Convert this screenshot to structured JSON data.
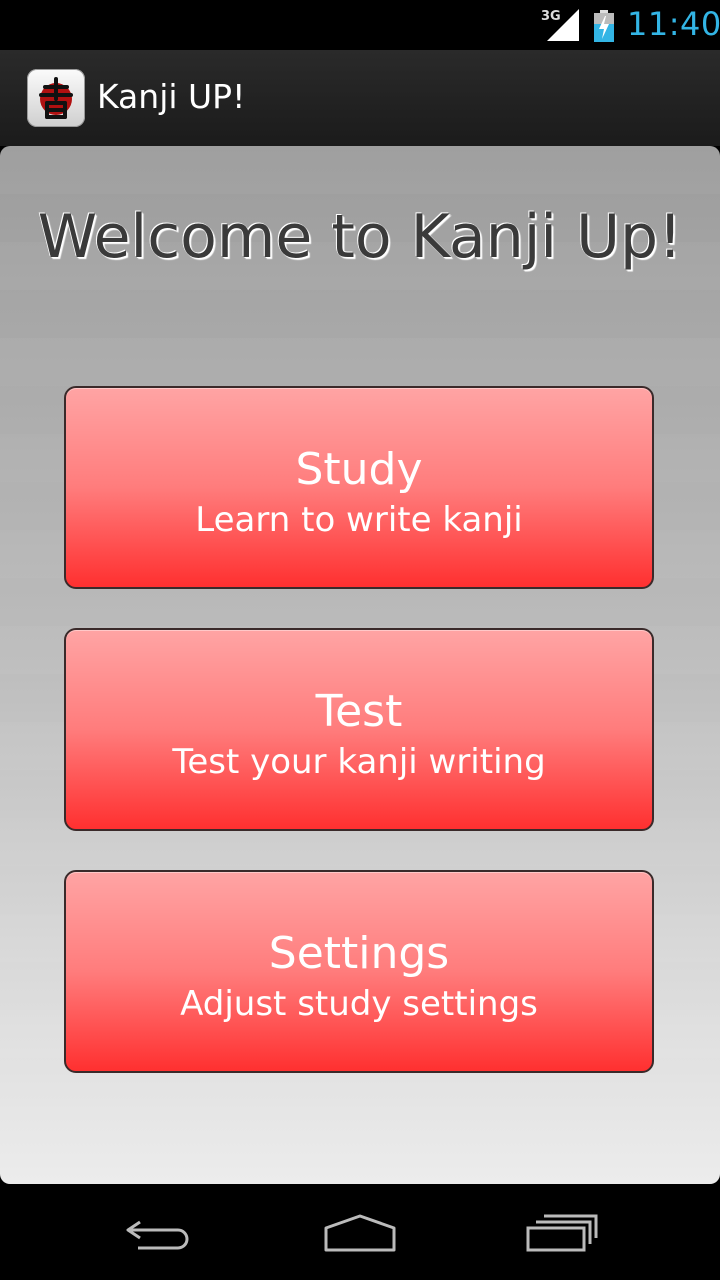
{
  "status_bar": {
    "network_label": "3G",
    "time": "11:40",
    "signal_icon": "signal-icon",
    "battery_icon": "battery-charging-icon"
  },
  "action_bar": {
    "app_icon": "kanji-app-icon",
    "title": "Kanji UP!"
  },
  "main": {
    "welcome": "Welcome to Kanji Up!",
    "buttons": [
      {
        "title": "Study",
        "subtitle": "Learn to write kanji"
      },
      {
        "title": "Test",
        "subtitle": "Test your kanji writing"
      },
      {
        "title": "Settings",
        "subtitle": "Adjust study settings"
      }
    ]
  },
  "nav_bar": {
    "back_icon": "back-icon",
    "home_icon": "home-icon",
    "recents_icon": "recents-icon"
  },
  "colors": {
    "accent": "#33b5e5",
    "button_top": "#ffa4a4",
    "button_bottom": "#ff3030"
  }
}
